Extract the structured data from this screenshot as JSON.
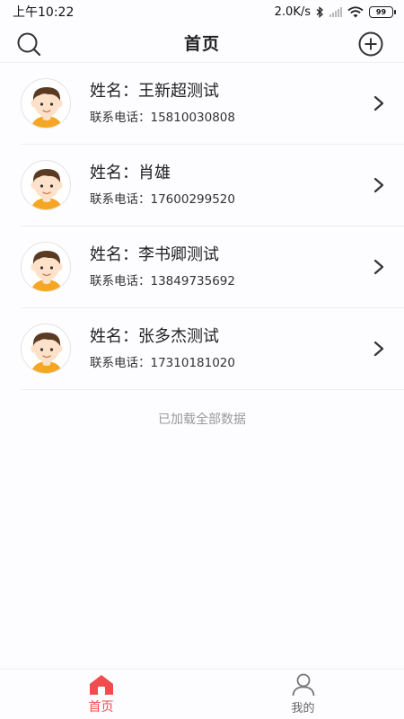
{
  "status_bar": {
    "time": "上午10:22",
    "network_speed": "2.0K/s",
    "battery": "99"
  },
  "header": {
    "title": "首页"
  },
  "contacts": [
    {
      "name": "姓名：王新超测试",
      "phone": "联系电话：15810030808"
    },
    {
      "name": "姓名：肖雄",
      "phone": "联系电话：17600299520"
    },
    {
      "name": "姓名：李书卿测试",
      "phone": "联系电话：13849735692"
    },
    {
      "name": "姓名：张多杰测试",
      "phone": "联系电话：17310181020"
    }
  ],
  "list_footer": "已加载全部数据",
  "tabs": [
    {
      "label": "首页",
      "icon": "home-icon",
      "active": true
    },
    {
      "label": "我的",
      "icon": "user-icon",
      "active": false
    }
  ],
  "colors": {
    "accent": "#f04e4e",
    "skin": "#fde1c8",
    "hair": "#5a3a22",
    "shirt": "#f5a623"
  }
}
